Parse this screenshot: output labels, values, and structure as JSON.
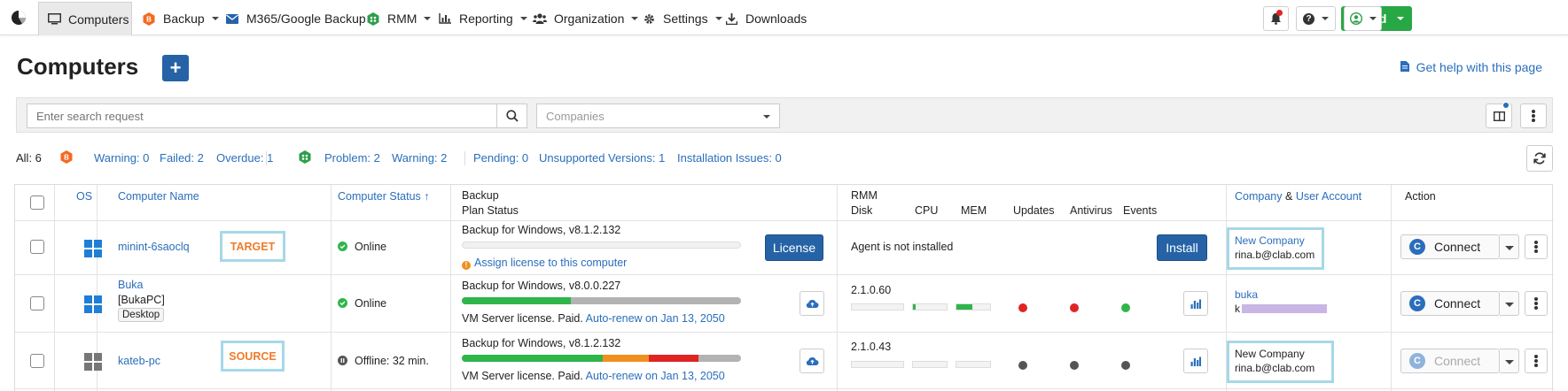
{
  "nav": {
    "computers": "Computers",
    "backup": "Backup",
    "m365": "M365/Google Backup",
    "rmm": "RMM",
    "reporting": "Reporting",
    "organization": "Organization",
    "settings": "Settings",
    "downloads": "Downloads",
    "add": "Add"
  },
  "header": {
    "title": "Computers",
    "help": "Get help with this page"
  },
  "search": {
    "placeholder": "Enter search request",
    "companies_placeholder": "Companies"
  },
  "stats": {
    "all": "All: 6",
    "warning_backup": "Warning: 0",
    "failed": "Failed: 2",
    "overdue": "Overdue: 1",
    "problem": "Problem: 2",
    "warning_rmm": "Warning: 2",
    "pending": "Pending: 0",
    "unsupported": "Unsupported Versions: 1",
    "install_issues": "Installation Issues: 0"
  },
  "columns": {
    "os": "OS",
    "name": "Computer Name",
    "status": "Computer Status ↑",
    "backup": "Backup",
    "plan_status": "Plan Status",
    "rmm": "RMM",
    "disk": "Disk",
    "cpu": "CPU",
    "mem": "MEM",
    "updates": "Updates",
    "antivirus": "Antivirus",
    "events": "Events",
    "company": "Company",
    "amp": "&",
    "user_account": "User Account",
    "action": "Action"
  },
  "rows": [
    {
      "name": "minint-6saoclq",
      "tag": "TARGET",
      "status": "Online",
      "backup_version": "Backup for Windows, v8.1.2.132",
      "assign_license": "Assign license to this computer",
      "license_btn": "License",
      "rmm_text": "Agent is not installed",
      "install_btn": "Install",
      "company": "New Company",
      "user": "rina.b@clab.com",
      "connect": "Connect"
    },
    {
      "name": "Buka",
      "subname": "[BukaPC]",
      "type": "Desktop",
      "status": "Online",
      "backup_version": "Backup for Windows, v8.0.0.227",
      "license_text": "VM Server license. Paid.",
      "auto_renew": "Auto-renew on Jan 13, 2050",
      "rmm_version": "2.1.0.60",
      "company": "buka",
      "user": "k",
      "connect": "Connect"
    },
    {
      "name": "kateb-pc",
      "tag": "SOURCE",
      "status": "Offline: 32 min.",
      "backup_version": "Backup for Windows, v8.1.2.132",
      "license_text": "VM Server license. Paid.",
      "auto_renew": "Auto-renew on Jan 13, 2050",
      "rmm_version": "2.1.0.43",
      "company": "New Company",
      "user": "rina.b@clab.com",
      "connect": "Connect"
    }
  ],
  "colors": {
    "primary": "#2563a6",
    "success": "#28a745",
    "link": "#2a6ebb",
    "danger": "#e02424",
    "warning": "#f0901e",
    "highlight": "#a6d8e8",
    "tag": "#f07b2a"
  }
}
